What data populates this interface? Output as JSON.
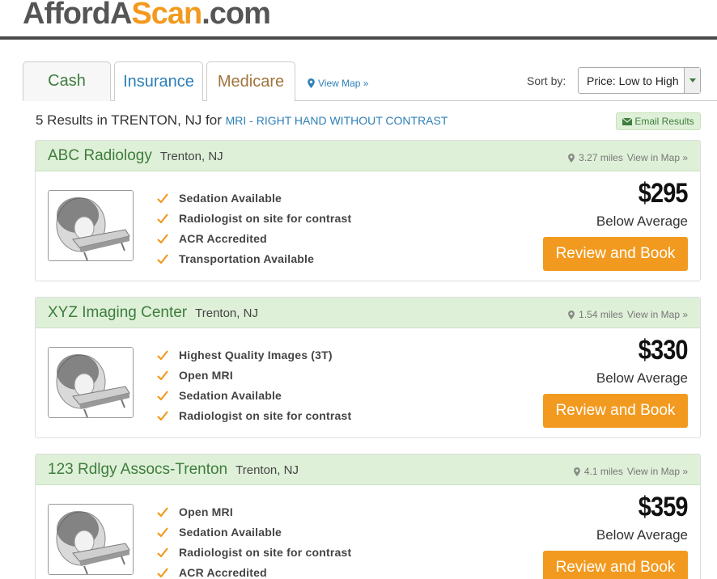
{
  "header": {
    "logo_part1": "AffordA",
    "logo_part2": "Scan",
    "logo_part3": ".com"
  },
  "tabs": [
    {
      "label": "Cash"
    },
    {
      "label": "Insurance"
    },
    {
      "label": "Medicare"
    }
  ],
  "view_map_label": "View Map »",
  "sort": {
    "label": "Sort by:",
    "selected": "Price: Low to High"
  },
  "results": {
    "summary": "5 Results in TRENTON, NJ for",
    "procedure": "MRI - RIGHT HAND WITHOUT CONTRAST",
    "email_label": "Email Results"
  },
  "cards": [
    {
      "name": "ABC Radiology",
      "city": "Trenton, NJ",
      "distance": "3.27 miles",
      "view_map": "View in Map »",
      "features": [
        "Sedation Available",
        "Radiologist on site for contrast",
        "ACR Accredited",
        "Transportation Available"
      ],
      "price": "$295",
      "price_note": "Below Average",
      "book_label": "Review and Book"
    },
    {
      "name": "XYZ Imaging Center",
      "city": "Trenton, NJ",
      "distance": "1.54 miles",
      "view_map": "View in Map »",
      "features": [
        "Highest Quality Images (3T)",
        "Open MRI",
        "Sedation Available",
        "Radiologist on site for contrast"
      ],
      "price": "$330",
      "price_note": "Below Average",
      "book_label": "Review and Book"
    },
    {
      "name": "123 Rdlgy Assocs-Trenton",
      "city": "Trenton, NJ",
      "distance": "4.1 miles",
      "view_map": "View in Map »",
      "features": [
        "Open MRI",
        "Sedation Available",
        "Radiologist on site for contrast",
        "ACR Accredited"
      ],
      "price": "$359",
      "price_note": "Below Average",
      "book_label": "Review and Book"
    }
  ],
  "colors": {
    "green": "#3e7d3e",
    "orange": "#f29a1f",
    "blue": "#2d7fb8",
    "brown": "#a0743b"
  },
  "icons": [
    "map-pin-icon",
    "envelope-icon",
    "checkmark-icon",
    "chevron-down-icon",
    "mri-scanner-image"
  ]
}
